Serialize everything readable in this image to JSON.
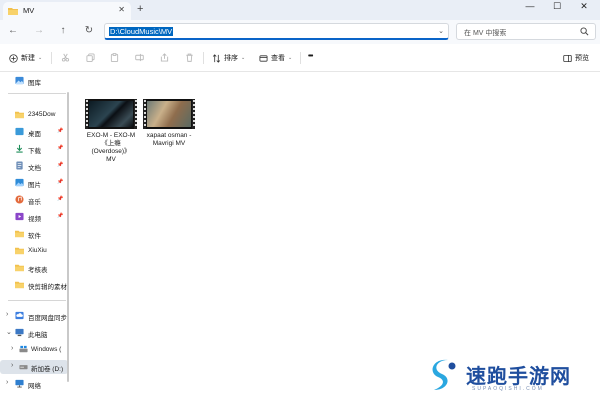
{
  "window": {
    "tab_title": "MV",
    "close_tab_glyph": "✕",
    "new_tab_glyph": "+",
    "minimize_glyph": "—",
    "maximize_glyph": "☐",
    "close_glyph": "✕"
  },
  "nav": {
    "back_glyph": "←",
    "forward_glyph": "→",
    "up_glyph": "↑",
    "refresh_glyph": "↻"
  },
  "address": {
    "path": "D:\\CloudMusic\\MV",
    "dropdown_glyph": "⌄"
  },
  "search": {
    "placeholder": "在 MV 中搜索"
  },
  "toolbar": {
    "new_label": "新建",
    "sort_label": "排序",
    "view_label": "查看",
    "more_label": "•••",
    "preview_label": "预览",
    "caret_glyph": "⌄"
  },
  "sidebar": {
    "chevron_right": "›",
    "chevron_down": "⌄",
    "pin_glyph": "📌",
    "items": [
      {
        "label": "图库"
      },
      {
        "label": "2345Dow"
      },
      {
        "label": "桌面"
      },
      {
        "label": "下载"
      },
      {
        "label": "文档"
      },
      {
        "label": "图片"
      },
      {
        "label": "音乐"
      },
      {
        "label": "视频"
      },
      {
        "label": "软件"
      },
      {
        "label": "XiuXiu"
      },
      {
        "label": "考核表"
      },
      {
        "label": "快剪辑的素材"
      },
      {
        "label": "百度网盘同步"
      },
      {
        "label": "此电脑"
      },
      {
        "label": "Windows ("
      },
      {
        "label": "新加卷 (D:)"
      },
      {
        "label": "网络"
      }
    ]
  },
  "files": [
    {
      "name": "EXO-M - EXO-M《上瘾 (Overdose)》 MV",
      "lines": [
        "EXO-M - EXO-M",
        "《上瘾",
        "(Overdose)》",
        "MV"
      ]
    },
    {
      "name": "xapaat osman - Mavrigi MV",
      "lines": [
        "xapaat osman -",
        "Mavrigi MV"
      ]
    }
  ],
  "watermark": {
    "title": "速跑手游网",
    "subtitle": "SUPAOQISHI.COM"
  },
  "colors": {
    "accent": "#0067c0",
    "tabstrip": "#e9eef6",
    "selected": "#dde3ea"
  }
}
